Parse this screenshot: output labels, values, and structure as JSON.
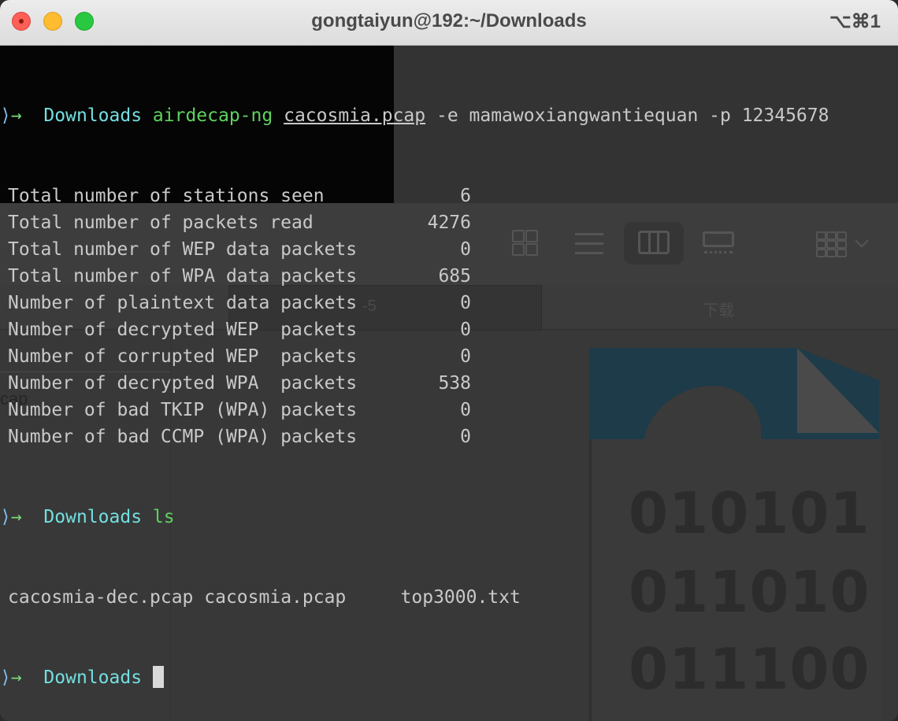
{
  "window": {
    "title": "gongtaiyun@192:~/Downloads",
    "shortcut": "⌥⌘1"
  },
  "background": {
    "tab_label": "-5",
    "download_label": "下载",
    "cap_label": "cap",
    "file_icon_binary": [
      "010101",
      "011010",
      "011100"
    ]
  },
  "terminal": {
    "prompt_dir": "Downloads",
    "command1": {
      "program": "airdecap-ng",
      "file": "cacosmia.pcap",
      "args": "-e mamawoxiangwantiequan -p 12345678"
    },
    "stats": [
      {
        "label": "Total number of stations seen",
        "value": "6"
      },
      {
        "label": "Total number of packets read",
        "value": "4276"
      },
      {
        "label": "Total number of WEP data packets",
        "value": "0"
      },
      {
        "label": "Total number of WPA data packets",
        "value": "685"
      },
      {
        "label": "Number of plaintext data packets",
        "value": "0"
      },
      {
        "label": "Number of decrypted WEP  packets",
        "value": "0"
      },
      {
        "label": "Number of corrupted WEP  packets",
        "value": "0"
      },
      {
        "label": "Number of decrypted WPA  packets",
        "value": "538"
      },
      {
        "label": "Number of bad TKIP (WPA) packets",
        "value": "0"
      },
      {
        "label": "Number of bad CCMP (WPA) packets",
        "value": "0"
      }
    ],
    "command2": "ls",
    "ls_output": [
      "cacosmia-dec.pcap",
      "cacosmia.pcap",
      "top3000.txt"
    ]
  }
}
